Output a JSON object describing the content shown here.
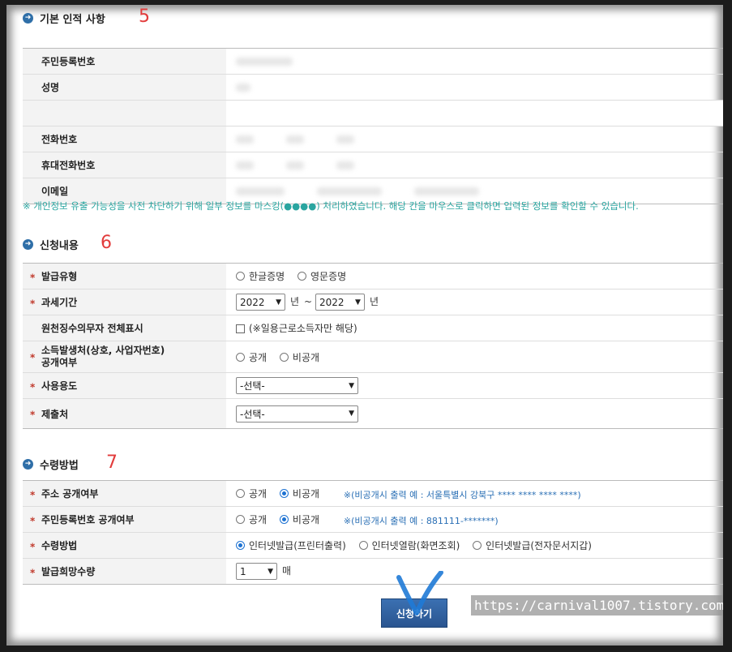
{
  "sections": {
    "basic": {
      "title": "기본 인적 사항",
      "step": "5",
      "rows": [
        {
          "label": "주민등록번호"
        },
        {
          "label": "성명"
        },
        {
          "label": "전화번호"
        },
        {
          "label": "휴대전화번호"
        },
        {
          "label": "이메일"
        }
      ],
      "notice": "※ 개인정보 유출 가능성을 사전 차단하기 위해 일부 정보를 마스킹(●●●●) 처리하였습니다. 해당 칸을 마우스로 클릭하면 입력된 정보를 확인할 수 있습니다."
    },
    "request": {
      "title": "신청내용",
      "step": "6",
      "issue_type": {
        "label": "발급유형",
        "opt1": "한글증명",
        "opt2": "영문증명"
      },
      "tax_period": {
        "label": "과세기간",
        "from": "2022",
        "to": "2022",
        "year_unit": "년",
        "tilde": "~"
      },
      "withholding": {
        "label": "원천징수의무자 전체표시",
        "checkbox_text": "(※일용근로소득자만 해당)"
      },
      "disclosure": {
        "label_line1": "소득발생처(상호, 사업자번호)",
        "label_line2": "공개여부",
        "opt1": "공개",
        "opt2": "비공개"
      },
      "purpose": {
        "label": "사용용도",
        "value": "-선택-"
      },
      "submit_to": {
        "label": "제출처",
        "value": "-선택-"
      }
    },
    "receipt": {
      "title": "수령방법",
      "step": "7",
      "address": {
        "label": "주소 공개여부",
        "opt1": "공개",
        "opt2": "비공개",
        "hint": "※(비공개시 출력 예 : 서울특별시 강북구 **** **** **** ****)"
      },
      "rrn": {
        "label": "주민등록번호 공개여부",
        "opt1": "공개",
        "opt2": "비공개",
        "hint": "※(비공개시 출력 예 : 881111-*******)"
      },
      "method": {
        "label": "수령방법",
        "opt1": "인터넷발급(프린터출력)",
        "opt2": "인터넷열람(화면조회)",
        "opt3": "인터넷발급(전자문서지갑)"
      },
      "quantity": {
        "label": "발급희망수량",
        "value": "1",
        "unit": "매"
      }
    }
  },
  "apply_button": "신청하기",
  "watermark": "https://carnival1007.tistory.com",
  "colors": {
    "accent": "#2f6fa8",
    "required": "#c0392b",
    "notice": "#2aa5a0",
    "annotation": "#e23b3b"
  }
}
